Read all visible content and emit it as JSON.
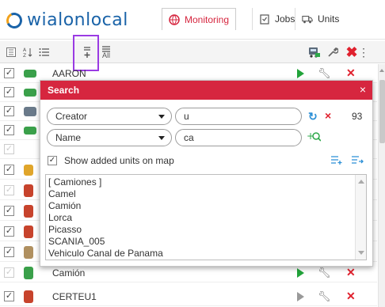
{
  "colors": {
    "accent": "#d6263f",
    "brand": "#1a63a8",
    "play": "#22a33a",
    "delete": "#e0212e",
    "highlight": "#9a3be3"
  },
  "header": {
    "logo_text": "wialon",
    "logo_text_2": "local",
    "nav": [
      {
        "label": "Monitoring",
        "icon": "globe-icon"
      },
      {
        "label": "Jobs",
        "icon": "clipboard-icon"
      },
      {
        "label": "Units",
        "icon": "truck-icon"
      }
    ]
  },
  "toolbar": {
    "icons": [
      "checklist-icon",
      "sort-az-icon",
      "list-icon",
      "add-to-list-icon",
      "show-all-icon",
      "truck-icon",
      "wrench-icon",
      "delete-icon",
      "more-icon"
    ],
    "all_label": "All"
  },
  "units": [
    {
      "name": "AARON",
      "checked": true
    },
    {
      "name": "",
      "checked": true
    },
    {
      "name": "",
      "checked": true
    },
    {
      "name": "",
      "checked": true
    },
    {
      "name": "",
      "checked": true
    },
    {
      "name": "",
      "checked": true
    },
    {
      "name": "",
      "checked": true
    },
    {
      "name": "",
      "checked": true
    },
    {
      "name": "",
      "checked": true
    },
    {
      "name": "",
      "checked": true
    },
    {
      "name": "",
      "checked": true
    },
    {
      "name": "Camión",
      "checked": true
    },
    {
      "name": "CERTEU1",
      "checked": true
    }
  ],
  "search": {
    "title": "Search",
    "close": "×",
    "criteria": [
      {
        "field": "Creator",
        "value": "u"
      },
      {
        "field": "Name",
        "value": "ca"
      }
    ],
    "count": "93",
    "show_on_map_label": "Show added units on map",
    "results": [
      "[ Camiones ]",
      "Camel",
      "Camión",
      "Lorca",
      "Picasso",
      "SCANIA_005",
      "Vehiculo Canal de Panama"
    ]
  }
}
